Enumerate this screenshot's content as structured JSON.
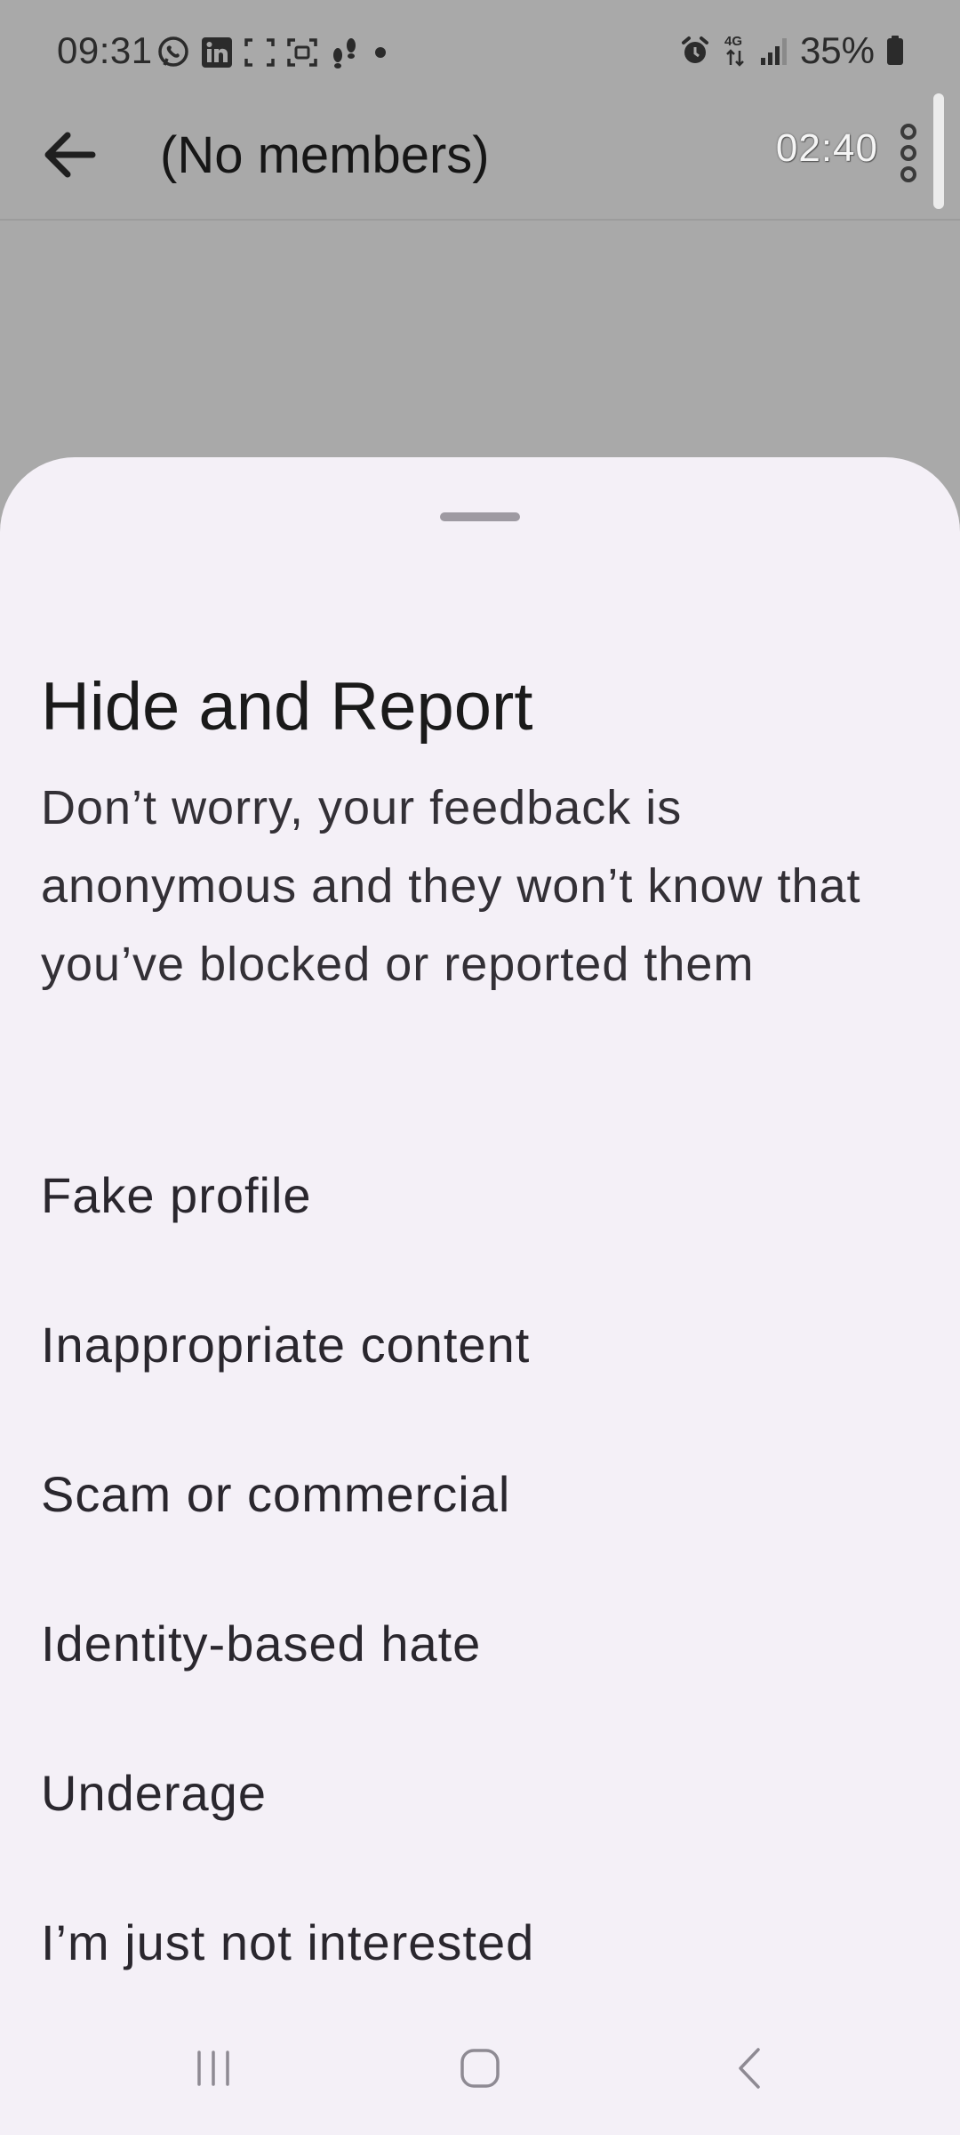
{
  "status_bar": {
    "time": "09:31",
    "battery": "35%",
    "notification_icons": [
      "viber-icon",
      "linkedin-icon",
      "screenshot-icon",
      "screen-record-icon",
      "footsteps-icon",
      "dot-icon"
    ],
    "system_icons": [
      "alarm-icon",
      "network-4g-icon",
      "signal-icon",
      "battery-icon"
    ]
  },
  "app_bar": {
    "title": "(No members)",
    "timer": "02:40"
  },
  "sheet": {
    "title": "Hide and Report",
    "description": "Don’t worry, your feedback is anonymous and they won’t know that you’ve blocked or reported them",
    "options": [
      "Fake profile",
      "Inappropriate content",
      "Scam or commercial",
      "Identity-based hate",
      "Underage",
      "I’m just not interested"
    ]
  },
  "colors": {
    "scrim": "#a9a9a9",
    "sheet_background": "#f4f0f7",
    "text_primary": "#1a1a1a",
    "handle": "#9e9aa2"
  }
}
